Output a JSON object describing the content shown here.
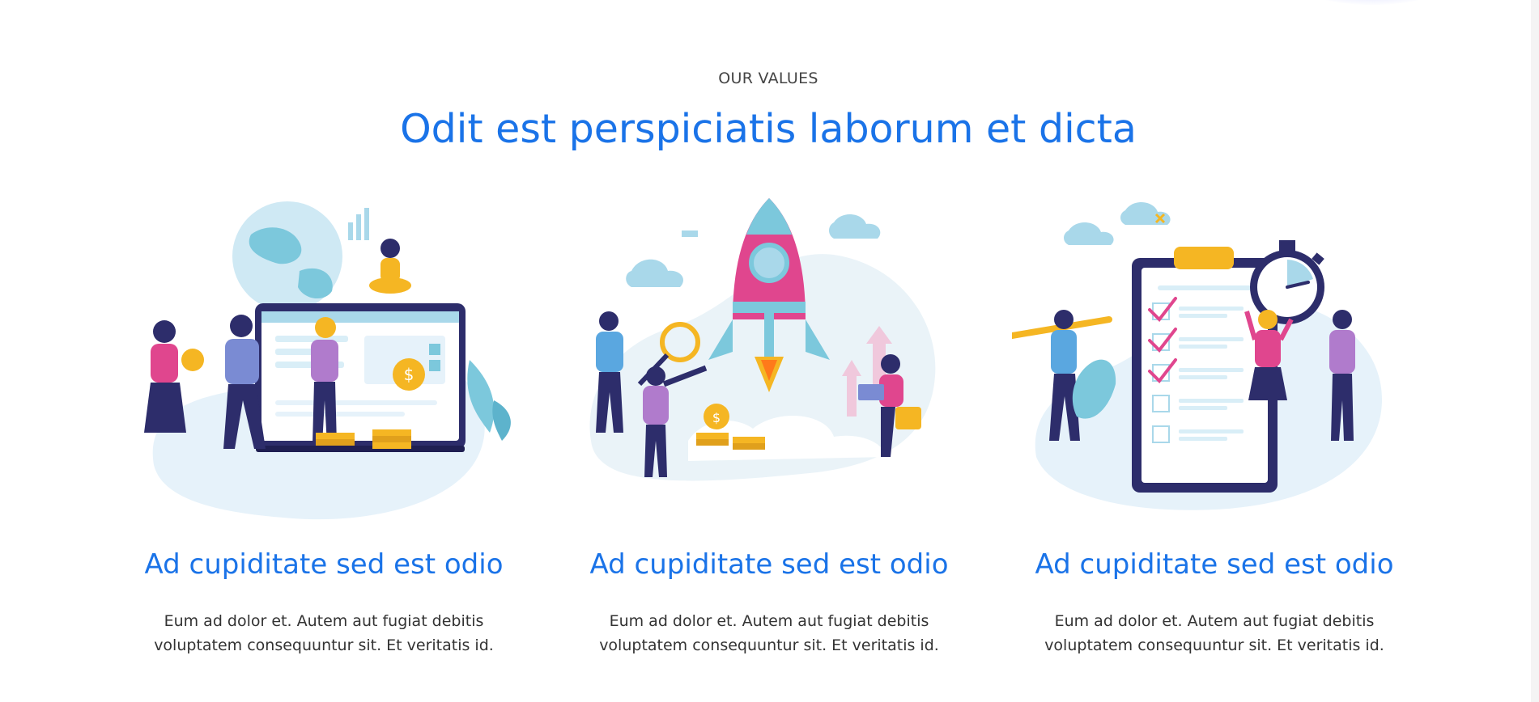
{
  "section": {
    "eyebrow": "OUR VALUES",
    "title": "Odit est perspiciatis laborum et dicta"
  },
  "cards": [
    {
      "illustration": "team-finance-screen-illustration",
      "title": "Ad cupiditate sed est odio",
      "text": "Eum ad dolor et. Autem aut fugiat debitis voluptatem consequuntur sit. Et veritatis id."
    },
    {
      "illustration": "rocket-launch-illustration",
      "title": "Ad cupiditate sed est odio",
      "text": "Eum ad dolor et. Autem aut fugiat debitis voluptatem consequuntur sit. Et veritatis id."
    },
    {
      "illustration": "checklist-stopwatch-illustration",
      "title": "Ad cupiditate sed est odio",
      "text": "Eum ad dolor et. Autem aut fugiat debitis voluptatem consequuntur sit. Et veritatis id."
    }
  ],
  "colors": {
    "accent": "#1a73e8",
    "navy": "#2d2d6b",
    "pink": "#e0468e",
    "teal": "#7cc8dc",
    "gold": "#f5b623",
    "blob": "#e6f2fa"
  }
}
